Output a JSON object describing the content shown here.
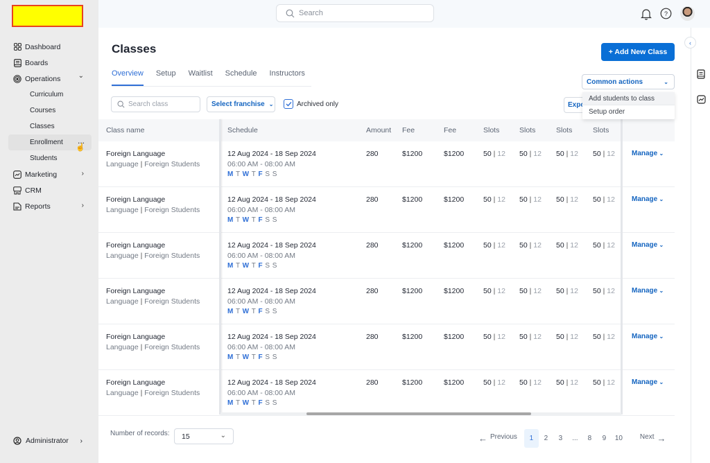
{
  "sidebar": {
    "logo_color": "#ffff00",
    "items": [
      {
        "label": "Dashboard",
        "icon": "dashboard-icon"
      },
      {
        "label": "Boards",
        "icon": "boards-icon"
      },
      {
        "label": "Operations",
        "icon": "operations-icon",
        "expanded": true,
        "children": [
          "Curriculum",
          "Courses",
          "Classes",
          "Enrollment",
          "Students"
        ]
      },
      {
        "label": "Marketing",
        "icon": "marketing-icon"
      },
      {
        "label": "CRM",
        "icon": "crm-icon"
      },
      {
        "label": "Reports",
        "icon": "reports-icon"
      }
    ],
    "hovered_child": "Enrollment",
    "hover_more": "...",
    "user": "Administrator"
  },
  "topbar": {
    "search_placeholder": "Search"
  },
  "page": {
    "title": "Classes",
    "tabs": [
      "Overview",
      "Setup",
      "Waitlist",
      "Schedule",
      "Instructors"
    ],
    "active_tab": "Overview",
    "add_button": "+ Add New Class",
    "common_actions": "Common actions",
    "common_actions_menu": [
      "Add students to class",
      "Setup order"
    ],
    "search_class_placeholder": "Search class",
    "franchise_select": "Select franchise",
    "archived_only": "Archived only",
    "archived_checked": true,
    "export_label": "Export"
  },
  "table": {
    "headers": [
      "Class name",
      "Schedule",
      "Amount",
      "Fee",
      "Fee",
      "Slots",
      "Slots",
      "Slots",
      "Slots",
      ""
    ],
    "rows": [
      {
        "name": "Foreign Language",
        "category": "Language",
        "audience": "Foreign Students",
        "dates": "12 Aug 2024 - 18 Sep 2024",
        "time": "06:00 AM - 08:00 AM",
        "amount": "280",
        "fee1": "$1200",
        "fee2": "$1200",
        "slots_total": "50",
        "slots_used": "12",
        "action": "Manage"
      },
      {
        "name": "Foreign Language",
        "category": "Language",
        "audience": "Foreign Students",
        "dates": "12 Aug 2024 - 18 Sep 2024",
        "time": "06:00 AM - 08:00 AM",
        "amount": "280",
        "fee1": "$1200",
        "fee2": "$1200",
        "slots_total": "50",
        "slots_used": "12",
        "action": "Manage"
      },
      {
        "name": "Foreign Language",
        "category": "Language",
        "audience": "Foreign Students",
        "dates": "12 Aug 2024 - 18 Sep 2024",
        "time": "06:00 AM - 08:00 AM",
        "amount": "280",
        "fee1": "$1200",
        "fee2": "$1200",
        "slots_total": "50",
        "slots_used": "12",
        "action": "Manage"
      },
      {
        "name": "Foreign Language",
        "category": "Language",
        "audience": "Foreign Students",
        "dates": "12 Aug 2024 - 18 Sep 2024",
        "time": "06:00 AM - 08:00 AM",
        "amount": "280",
        "fee1": "$1200",
        "fee2": "$1200",
        "slots_total": "50",
        "slots_used": "12",
        "action": "Manage"
      },
      {
        "name": "Foreign Language",
        "category": "Language",
        "audience": "Foreign Students",
        "dates": "12 Aug 2024 - 18 Sep 2024",
        "time": "06:00 AM - 08:00 AM",
        "amount": "280",
        "fee1": "$1200",
        "fee2": "$1200",
        "slots_total": "50",
        "slots_used": "12",
        "action": "Manage"
      },
      {
        "name": "Foreign Language",
        "category": "Language",
        "audience": "Foreign Students",
        "dates": "12 Aug 2024 - 18 Sep 2024",
        "time": "06:00 AM - 08:00 AM",
        "amount": "280",
        "fee1": "$1200",
        "fee2": "$1200",
        "slots_total": "50",
        "slots_used": "12",
        "action": "Manage"
      }
    ],
    "days": [
      {
        "d": "M",
        "on": true
      },
      {
        "d": "T",
        "on": false
      },
      {
        "d": "W",
        "on": true
      },
      {
        "d": "T",
        "on": false
      },
      {
        "d": "F",
        "on": true
      },
      {
        "d": "S",
        "on": false
      },
      {
        "d": "S",
        "on": false
      }
    ]
  },
  "footer": {
    "records_label": "Number of records:",
    "records_value": "15",
    "previous": "Previous",
    "next": "Next",
    "pages": [
      "1",
      "2",
      "3",
      "...",
      "8",
      "9",
      "10"
    ],
    "current_page": "1"
  }
}
